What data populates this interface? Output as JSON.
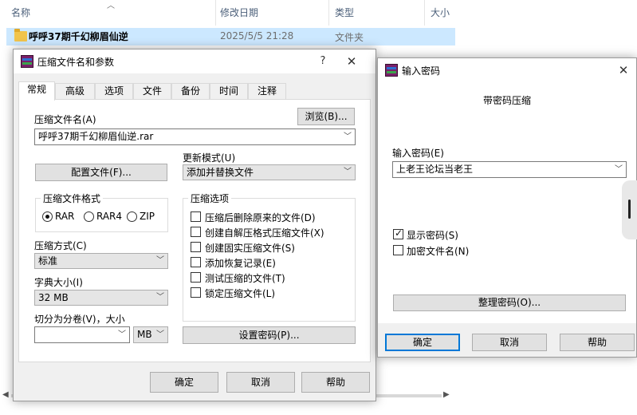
{
  "explorer": {
    "columns": [
      "名称",
      "修改日期",
      "类型",
      "大小"
    ],
    "row": {
      "name": "呼呼37期千幻柳眉仙逆",
      "date": "2025/5/5 21:28",
      "type": "文件夹"
    }
  },
  "archive_dialog": {
    "title": "压缩文件名和参数",
    "help_symbol": "?",
    "close_symbol": "✕",
    "tabs": [
      "常规",
      "高级",
      "选项",
      "文件",
      "备份",
      "时间",
      "注释"
    ],
    "archive_name_label": "压缩文件名(A)",
    "archive_name_value": "呼呼37期千幻柳眉仙逆.rar",
    "browse_button": "浏览(B)...",
    "update_mode_label": "更新模式(U)",
    "update_mode_value": "添加并替换文件",
    "profiles_button": "配置文件(F)...",
    "format_group": "压缩文件格式",
    "formats": [
      {
        "label": "RAR",
        "selected": true
      },
      {
        "label": "RAR4",
        "selected": false
      },
      {
        "label": "ZIP",
        "selected": false
      }
    ],
    "method_label": "压缩方式(C)",
    "method_value": "标准",
    "dict_label": "字典大小(I)",
    "dict_value": "32 MB",
    "split_label": "切分为分卷(V)，大小",
    "split_value": "",
    "split_unit": "MB",
    "options_group": "压缩选项",
    "options": [
      {
        "label": "压缩后删除原来的文件(D)",
        "checked": false
      },
      {
        "label": "创建自解压格式压缩文件(X)",
        "checked": false
      },
      {
        "label": "创建固实压缩文件(S)",
        "checked": false
      },
      {
        "label": "添加恢复记录(E)",
        "checked": false
      },
      {
        "label": "测试压缩的文件(T)",
        "checked": false
      },
      {
        "label": "锁定压缩文件(L)",
        "checked": false
      }
    ],
    "set_password_button": "设置密码(P)...",
    "ok": "确定",
    "cancel": "取消",
    "help": "帮助"
  },
  "password_dialog": {
    "title": "输入密码",
    "close_symbol": "✕",
    "heading": "带密码压缩",
    "password_label": "输入密码(E)",
    "password_value": "上老王论坛当老王",
    "show_password": {
      "label": "显示密码(S)",
      "checked": true
    },
    "encrypt_names": {
      "label": "加密文件名(N)",
      "checked": false
    },
    "organize_button": "整理密码(O)...",
    "ok": "确定",
    "cancel": "取消",
    "help": "帮助"
  },
  "colors": {
    "selection": "#cce8ff",
    "accent": "#0078d7",
    "folder": "#f1c44c"
  }
}
